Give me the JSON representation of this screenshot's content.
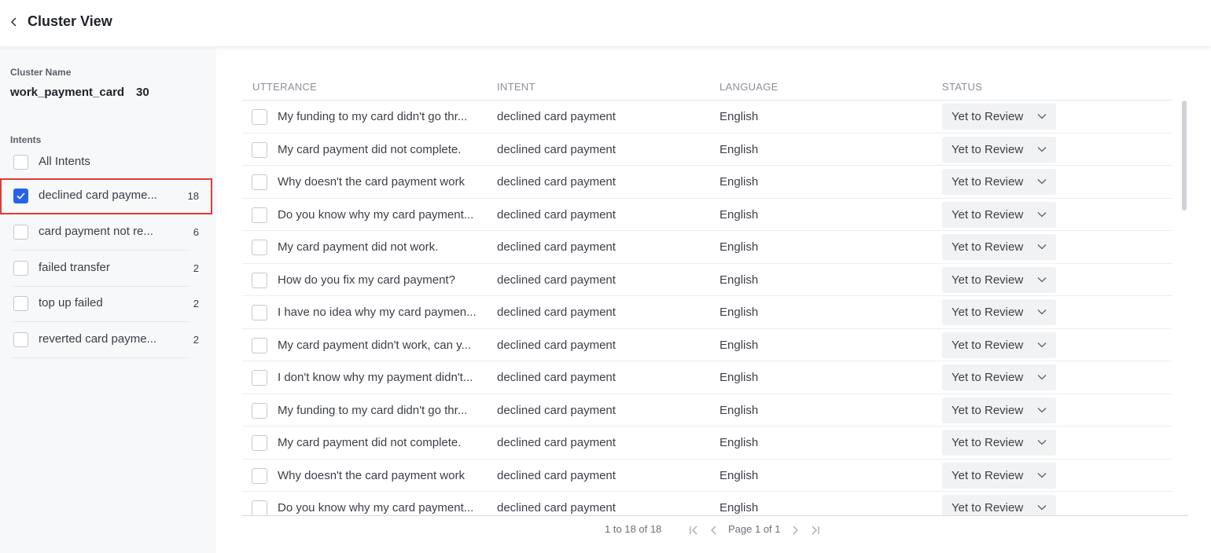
{
  "header": {
    "title": "Cluster View",
    "back_icon": "chevron-left-icon"
  },
  "sidebar": {
    "cluster_label": "Cluster Name",
    "cluster_name": "work_payment_card",
    "cluster_count": "30",
    "intents_label": "Intents",
    "intents": [
      {
        "label": "All Intents",
        "count": "",
        "checked": false
      },
      {
        "label": "declined card payme...",
        "count": "18",
        "checked": true
      },
      {
        "label": "card payment not re...",
        "count": "6",
        "checked": false
      },
      {
        "label": "failed transfer",
        "count": "2",
        "checked": false
      },
      {
        "label": "top up failed",
        "count": "2",
        "checked": false
      },
      {
        "label": "reverted card payme...",
        "count": "2",
        "checked": false
      }
    ]
  },
  "table": {
    "columns": [
      "UTTERANCE",
      "INTENT",
      "LANGUAGE",
      "STATUS"
    ],
    "rows": [
      {
        "utterance": "My funding to my card didn't go thr...",
        "intent": "declined card payment",
        "language": "English",
        "status": "Yet to Review"
      },
      {
        "utterance": "My card payment did not complete.",
        "intent": "declined card payment",
        "language": "English",
        "status": "Yet to Review"
      },
      {
        "utterance": "Why doesn't the card payment work",
        "intent": "declined card payment",
        "language": "English",
        "status": "Yet to Review"
      },
      {
        "utterance": "Do you know why my card payment...",
        "intent": "declined card payment",
        "language": "English",
        "status": "Yet to Review"
      },
      {
        "utterance": "My card payment did not work.",
        "intent": "declined card payment",
        "language": "English",
        "status": "Yet to Review"
      },
      {
        "utterance": "How do you fix my card payment?",
        "intent": "declined card payment",
        "language": "English",
        "status": "Yet to Review"
      },
      {
        "utterance": "I have no idea why my card paymen...",
        "intent": "declined card payment",
        "language": "English",
        "status": "Yet to Review"
      },
      {
        "utterance": "My card payment didn't work, can y...",
        "intent": "declined card payment",
        "language": "English",
        "status": "Yet to Review"
      },
      {
        "utterance": "I don't know why my payment didn't...",
        "intent": "declined card payment",
        "language": "English",
        "status": "Yet to Review"
      },
      {
        "utterance": "My funding to my card didn't go thr...",
        "intent": "declined card payment",
        "language": "English",
        "status": "Yet to Review"
      },
      {
        "utterance": "My card payment did not complete.",
        "intent": "declined card payment",
        "language": "English",
        "status": "Yet to Review"
      },
      {
        "utterance": "Why doesn't the card payment work",
        "intent": "declined card payment",
        "language": "English",
        "status": "Yet to Review"
      },
      {
        "utterance": "Do you know why my card payment...",
        "intent": "declined card payment",
        "language": "English",
        "status": "Yet to Review"
      }
    ]
  },
  "pagination": {
    "range_text": "1 to 18 of 18",
    "page_text": "Page 1 of 1"
  },
  "colors": {
    "accent": "#2563eb",
    "selection_outline": "#e53935"
  }
}
